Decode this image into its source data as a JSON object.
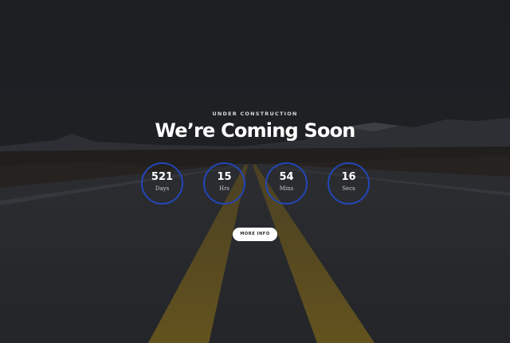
{
  "hero": {
    "eyebrow": "UNDER CONSTRUCTION",
    "title": "We’re Coming Soon"
  },
  "countdown": [
    {
      "value": "521",
      "label": "Days"
    },
    {
      "value": "15",
      "label": "Hrs"
    },
    {
      "value": "54",
      "label": "Mins"
    },
    {
      "value": "16",
      "label": "Secs"
    }
  ],
  "cta": {
    "label": "MORE INFO"
  },
  "colors": {
    "ring": "#2346b8",
    "button_bg": "#ffffff",
    "road_line": "#c79a1c"
  }
}
